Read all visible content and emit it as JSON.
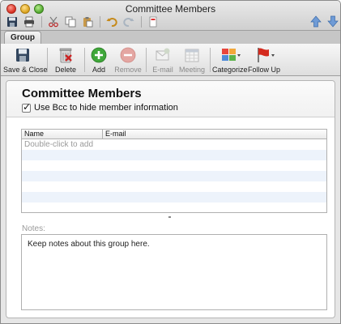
{
  "window": {
    "title": "Committee Members"
  },
  "quick_toolbar": {
    "left_icons": [
      "save-icon",
      "print-icon",
      "cut-icon",
      "copy-icon",
      "paste-icon",
      "undo-icon",
      "redo-icon",
      "note-icon"
    ],
    "right_icons": [
      "arrow-up-icon",
      "arrow-down-icon"
    ]
  },
  "ribbon": {
    "tab": "Group",
    "buttons": [
      {
        "id": "save-close",
        "label": "Save & Close",
        "enabled": true
      },
      {
        "id": "delete",
        "label": "Delete",
        "enabled": true
      },
      {
        "id": "add",
        "label": "Add",
        "enabled": true
      },
      {
        "id": "remove",
        "label": "Remove",
        "enabled": false
      },
      {
        "id": "email",
        "label": "E-mail",
        "enabled": false
      },
      {
        "id": "meeting",
        "label": "Meeting",
        "enabled": false
      },
      {
        "id": "categorize",
        "label": "Categorize",
        "enabled": true
      },
      {
        "id": "follow-up",
        "label": "Follow Up",
        "enabled": true
      }
    ]
  },
  "group": {
    "name": "Committee Members",
    "bcc_checked": true,
    "bcc_label": "Use Bcc to hide member information"
  },
  "members_table": {
    "columns": [
      "Name",
      "E-mail"
    ],
    "placeholder": "Double-click to add"
  },
  "notes": {
    "label": "Notes:",
    "text": "Keep notes about this group here."
  },
  "colors": {
    "add_green": "#3fa73a",
    "alt_row": "#edf3fb",
    "flag_red": "#d42a1e"
  }
}
